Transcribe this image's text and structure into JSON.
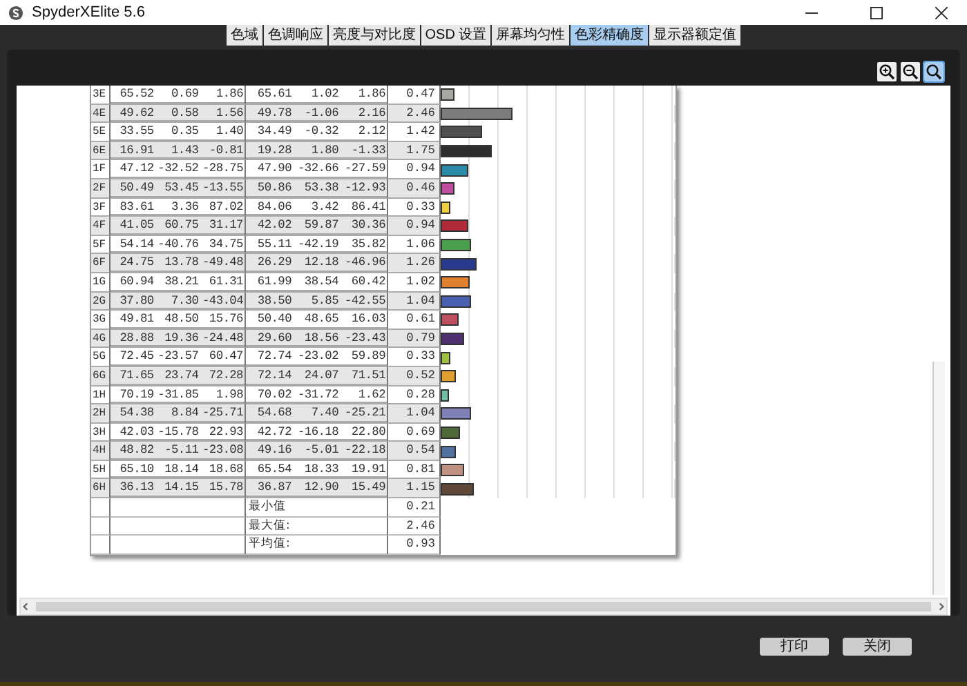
{
  "window": {
    "title": "SpyderXElite 5.6"
  },
  "tabs": [
    {
      "label": "色域",
      "selected": false
    },
    {
      "label": "色调响应",
      "selected": false
    },
    {
      "label": "亮度与对比度",
      "selected": false
    },
    {
      "label": "OSD 设置",
      "selected": false
    },
    {
      "label": "屏幕均匀性",
      "selected": false
    },
    {
      "label": "色彩精确度",
      "selected": true
    },
    {
      "label": "显示器额定值",
      "selected": false
    }
  ],
  "zoom_tools": [
    {
      "kind": "zoom-in",
      "selected": false
    },
    {
      "kind": "zoom-out",
      "selected": false
    },
    {
      "kind": "zoom-fit",
      "selected": true
    }
  ],
  "rows": [
    {
      "patch": "3E",
      "ref": [
        "65.52",
        "0.69",
        "1.86"
      ],
      "meas": [
        "65.61",
        "1.02",
        "1.86"
      ],
      "de": "0.47",
      "color": "#a9a7a4"
    },
    {
      "patch": "4E",
      "ref": [
        "49.62",
        "0.58",
        "1.56"
      ],
      "meas": [
        "49.78",
        "-1.06",
        "2.16"
      ],
      "de": "2.46",
      "color": "#7b7b79"
    },
    {
      "patch": "5E",
      "ref": [
        "33.55",
        "0.35",
        "1.40"
      ],
      "meas": [
        "34.49",
        "-0.32",
        "2.12"
      ],
      "de": "1.42",
      "color": "#4f4f4d"
    },
    {
      "patch": "6E",
      "ref": [
        "16.91",
        "1.43",
        "-0.81"
      ],
      "meas": [
        "19.28",
        "1.80",
        "-1.33"
      ],
      "de": "1.75",
      "color": "#2e2e2e"
    },
    {
      "patch": "1F",
      "ref": [
        "47.12",
        "-32.52",
        "-28.75"
      ],
      "meas": [
        "47.90",
        "-32.66",
        "-27.59"
      ],
      "de": "0.94",
      "color": "#2a8aa8"
    },
    {
      "patch": "2F",
      "ref": [
        "50.49",
        "53.45",
        "-13.55"
      ],
      "meas": [
        "50.86",
        "53.38",
        "-12.93"
      ],
      "de": "0.46",
      "color": "#c04ea0"
    },
    {
      "patch": "3F",
      "ref": [
        "83.61",
        "3.36",
        "87.02"
      ],
      "meas": [
        "84.06",
        "3.42",
        "86.41"
      ],
      "de": "0.33",
      "color": "#f0d040"
    },
    {
      "patch": "4F",
      "ref": [
        "41.05",
        "60.75",
        "31.17"
      ],
      "meas": [
        "42.02",
        "59.87",
        "30.36"
      ],
      "de": "0.94",
      "color": "#b02a3a"
    },
    {
      "patch": "5F",
      "ref": [
        "54.14",
        "-40.76",
        "34.75"
      ],
      "meas": [
        "55.11",
        "-42.19",
        "35.82"
      ],
      "de": "1.06",
      "color": "#4aa04a"
    },
    {
      "patch": "6F",
      "ref": [
        "24.75",
        "13.78",
        "-49.48"
      ],
      "meas": [
        "26.29",
        "12.18",
        "-46.96"
      ],
      "de": "1.26",
      "color": "#283a8c"
    },
    {
      "patch": "1G",
      "ref": [
        "60.94",
        "38.21",
        "61.31"
      ],
      "meas": [
        "61.99",
        "38.54",
        "60.42"
      ],
      "de": "1.02",
      "color": "#e08030"
    },
    {
      "patch": "2G",
      "ref": [
        "37.80",
        "7.30",
        "-43.04"
      ],
      "meas": [
        "38.50",
        "5.85",
        "-42.55"
      ],
      "de": "1.04",
      "color": "#4a60b0"
    },
    {
      "patch": "3G",
      "ref": [
        "49.81",
        "48.50",
        "15.76"
      ],
      "meas": [
        "50.40",
        "48.65",
        "16.03"
      ],
      "de": "0.61",
      "color": "#c05060"
    },
    {
      "patch": "4G",
      "ref": [
        "28.88",
        "19.36",
        "-24.48"
      ],
      "meas": [
        "29.60",
        "18.56",
        "-23.43"
      ],
      "de": "0.79",
      "color": "#503070"
    },
    {
      "patch": "5G",
      "ref": [
        "72.45",
        "-23.57",
        "60.47"
      ],
      "meas": [
        "72.74",
        "-23.02",
        "59.89"
      ],
      "de": "0.33",
      "color": "#a0c040"
    },
    {
      "patch": "6G",
      "ref": [
        "71.65",
        "23.74",
        "72.28"
      ],
      "meas": [
        "72.14",
        "24.07",
        "71.51"
      ],
      "de": "0.52",
      "color": "#e0a030"
    },
    {
      "patch": "1H",
      "ref": [
        "70.19",
        "-31.85",
        "1.98"
      ],
      "meas": [
        "70.02",
        "-31.72",
        "1.62"
      ],
      "de": "0.28",
      "color": "#70c0a8"
    },
    {
      "patch": "2H",
      "ref": [
        "54.38",
        "8.84",
        "-25.71"
      ],
      "meas": [
        "54.68",
        "7.40",
        "-25.21"
      ],
      "de": "1.04",
      "color": "#8080b8"
    },
    {
      "patch": "3H",
      "ref": [
        "42.03",
        "-15.78",
        "22.93"
      ],
      "meas": [
        "42.72",
        "-16.18",
        "22.80"
      ],
      "de": "0.69",
      "color": "#506838"
    },
    {
      "patch": "4H",
      "ref": [
        "48.82",
        "-5.11",
        "-23.08"
      ],
      "meas": [
        "49.16",
        "-5.01",
        "-22.18"
      ],
      "de": "0.54",
      "color": "#5070a0"
    },
    {
      "patch": "5H",
      "ref": [
        "65.10",
        "18.14",
        "18.68"
      ],
      "meas": [
        "65.54",
        "18.33",
        "19.91"
      ],
      "de": "0.81",
      "color": "#c09080"
    },
    {
      "patch": "6H",
      "ref": [
        "36.13",
        "14.15",
        "15.78"
      ],
      "meas": [
        "36.87",
        "12.90",
        "15.49"
      ],
      "de": "1.15",
      "color": "#604838"
    }
  ],
  "summary": [
    {
      "label": "最小值",
      "value": "0.21"
    },
    {
      "label": "最大值:",
      "value": "2.46"
    },
    {
      "label": "平均值:",
      "value": "0.93"
    }
  ],
  "buttons": [
    "打印",
    "关闭"
  ]
}
